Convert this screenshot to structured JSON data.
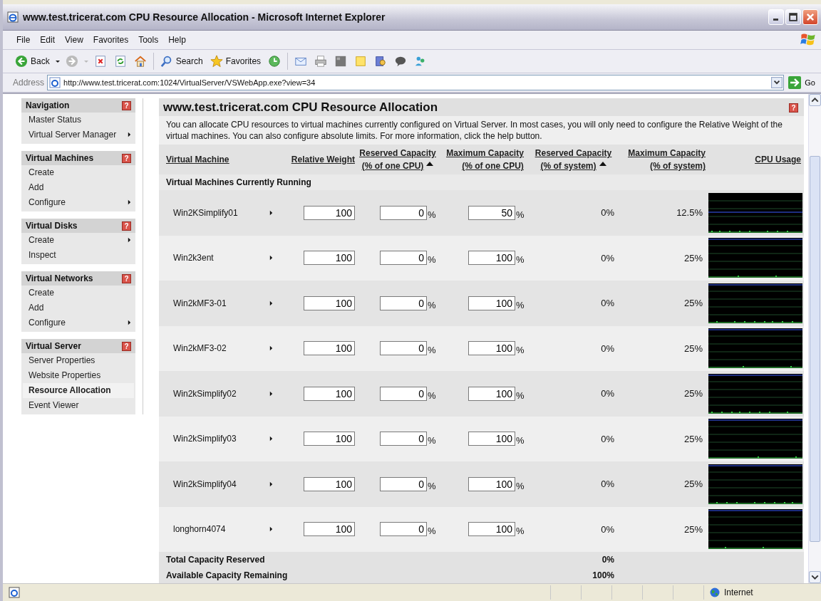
{
  "window": {
    "title": "www.test.tricerat.com CPU Resource Allocation - Microsoft Internet Explorer"
  },
  "menu": [
    "File",
    "Edit",
    "View",
    "Favorites",
    "Tools",
    "Help"
  ],
  "toolbar": {
    "back": "Back",
    "search": "Search",
    "favorites": "Favorites"
  },
  "address": {
    "label": "Address",
    "url": "http://www.test.tricerat.com:1024/VirtualServer/VSWebApp.exe?view=34",
    "go": "Go"
  },
  "sidebar": [
    {
      "title": "Navigation",
      "help": "?",
      "items": [
        {
          "label": "Master Status",
          "submenu": false,
          "selected": false
        },
        {
          "label": "Virtual Server Manager",
          "submenu": true,
          "selected": false
        }
      ]
    },
    {
      "title": "Virtual Machines",
      "help": "?",
      "items": [
        {
          "label": "Create",
          "submenu": false,
          "selected": false
        },
        {
          "label": "Add",
          "submenu": false,
          "selected": false
        },
        {
          "label": "Configure",
          "submenu": true,
          "selected": false
        }
      ]
    },
    {
      "title": "Virtual Disks",
      "help": "?",
      "items": [
        {
          "label": "Create",
          "submenu": true,
          "selected": false
        },
        {
          "label": "Inspect",
          "submenu": false,
          "selected": false
        }
      ]
    },
    {
      "title": "Virtual Networks",
      "help": "?",
      "items": [
        {
          "label": "Create",
          "submenu": false,
          "selected": false
        },
        {
          "label": "Add",
          "submenu": false,
          "selected": false
        },
        {
          "label": "Configure",
          "submenu": true,
          "selected": false
        }
      ]
    },
    {
      "title": "Virtual Server",
      "help": "?",
      "items": [
        {
          "label": "Server Properties",
          "submenu": false,
          "selected": false
        },
        {
          "label": "Website Properties",
          "submenu": false,
          "selected": false
        },
        {
          "label": "Resource Allocation",
          "submenu": false,
          "selected": true
        },
        {
          "label": "Event Viewer",
          "submenu": false,
          "selected": false
        }
      ]
    }
  ],
  "page": {
    "title": "www.test.tricerat.com CPU Resource Allocation",
    "help": "?",
    "description": "You can allocate CPU resources to virtual machines currently configured on Virtual Server. In most cases, you will only need to configure the Relative Weight of the virtual machines. You can also configure absolute limits. For more information, click the help button."
  },
  "columns": [
    {
      "lines": [
        "Virtual Machine"
      ],
      "sorted": false
    },
    {
      "lines": [
        "Relative Weight"
      ],
      "sorted": false
    },
    {
      "lines": [
        "Reserved Capacity",
        "(% of one CPU)"
      ],
      "sorted": true
    },
    {
      "lines": [
        "Maximum Capacity",
        "(% of one CPU)"
      ],
      "sorted": false
    },
    {
      "lines": [
        "Reserved Capacity",
        "(% of system)"
      ],
      "sorted": true
    },
    {
      "lines": [
        "Maximum Capacity",
        "(% of system)"
      ],
      "sorted": false
    },
    {
      "lines": [
        "CPU Usage"
      ],
      "sorted": false
    }
  ],
  "section_label": "Virtual Machines Currently Running",
  "rows": [
    {
      "name": "Win2KSimplify01",
      "weight": "100",
      "reserved": "0",
      "reserved_unit": "%",
      "maximum": "50",
      "maximum_unit": "%",
      "reserved_system": "0%",
      "maximum_system": "12.5%"
    },
    {
      "name": "Win2k3ent",
      "weight": "100",
      "reserved": "0",
      "reserved_unit": "%",
      "maximum": "100",
      "maximum_unit": "%",
      "reserved_system": "0%",
      "maximum_system": "25%"
    },
    {
      "name": "Win2kMF3-01",
      "weight": "100",
      "reserved": "0",
      "reserved_unit": "%",
      "maximum": "100",
      "maximum_unit": "%",
      "reserved_system": "0%",
      "maximum_system": "25%"
    },
    {
      "name": "Win2kMF3-02",
      "weight": "100",
      "reserved": "0",
      "reserved_unit": "%",
      "maximum": "100",
      "maximum_unit": "%",
      "reserved_system": "0%",
      "maximum_system": "25%"
    },
    {
      "name": "Win2kSimplify02",
      "weight": "100",
      "reserved": "0",
      "reserved_unit": "%",
      "maximum": "100",
      "maximum_unit": "%",
      "reserved_system": "0%",
      "maximum_system": "25%"
    },
    {
      "name": "Win2kSimplify03",
      "weight": "100",
      "reserved": "0",
      "reserved_unit": "%",
      "maximum": "100",
      "maximum_unit": "%",
      "reserved_system": "0%",
      "maximum_system": "25%"
    },
    {
      "name": "Win2kSimplify04",
      "weight": "100",
      "reserved": "0",
      "reserved_unit": "%",
      "maximum": "100",
      "maximum_unit": "%",
      "reserved_system": "0%",
      "maximum_system": "25%"
    },
    {
      "name": "longhorn4074",
      "weight": "100",
      "reserved": "0",
      "reserved_unit": "%",
      "maximum": "100",
      "maximum_unit": "%",
      "reserved_system": "0%",
      "maximum_system": "25%"
    }
  ],
  "totals": [
    {
      "label": "Total Capacity Reserved",
      "value": "0%"
    },
    {
      "label": "Available Capacity Remaining",
      "value": "100%"
    }
  ],
  "status_bar": {
    "zone": "Internet"
  }
}
